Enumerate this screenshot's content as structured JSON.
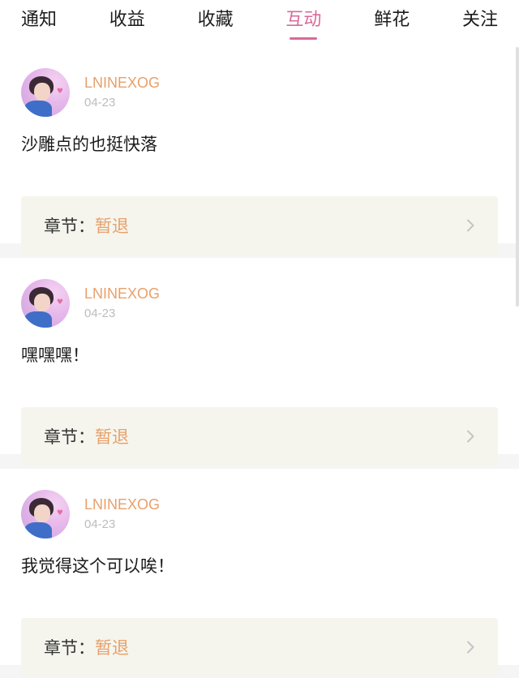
{
  "tabs": [
    {
      "label": "通知",
      "active": false
    },
    {
      "label": "收益",
      "active": false
    },
    {
      "label": "收藏",
      "active": false
    },
    {
      "label": "互动",
      "active": true
    },
    {
      "label": "鲜花",
      "active": false
    },
    {
      "label": "关注",
      "active": false
    }
  ],
  "colors": {
    "accent": "#d9699a",
    "username": "#e8a06a",
    "chapter_bg": "#f5f5ee"
  },
  "feed": [
    {
      "username": "LNINEXOG",
      "date": "04-23",
      "comment": "沙雕点的也挺快落",
      "chapter_label": "章节：",
      "chapter_name": "暂退",
      "arrow_icon": "chevron-right-icon"
    },
    {
      "username": "LNINEXOG",
      "date": "04-23",
      "comment": "嘿嘿嘿！",
      "chapter_label": "章节：",
      "chapter_name": "暂退",
      "arrow_icon": "chevron-right-icon"
    },
    {
      "username": "LNINEXOG",
      "date": "04-23",
      "comment": "我觉得这个可以唉！",
      "chapter_label": "章节：",
      "chapter_name": "暂退",
      "arrow_icon": "chevron-right-icon"
    }
  ]
}
